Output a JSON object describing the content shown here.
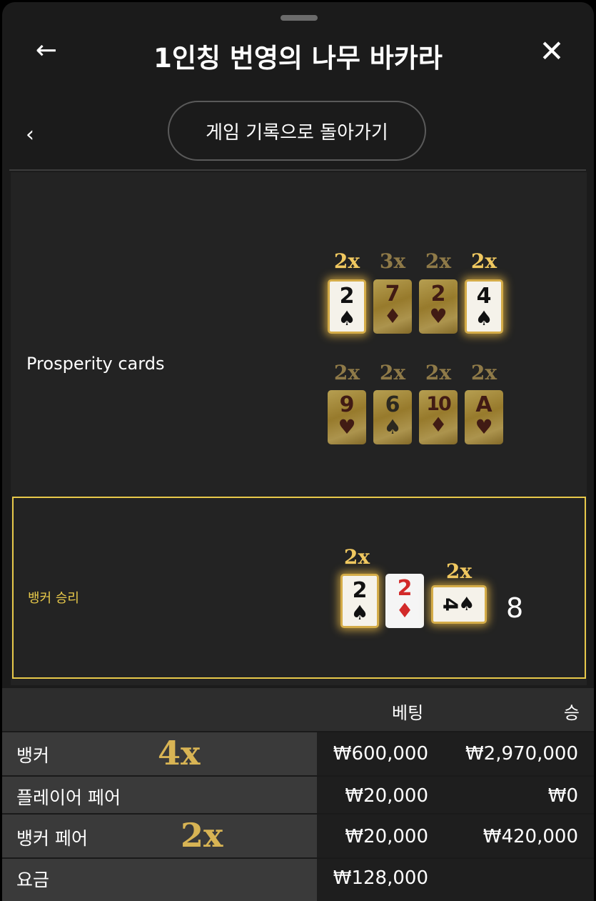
{
  "header": {
    "title": "1인칭 번영의 나무 바카라",
    "back_icon": "←",
    "close_icon": "✕"
  },
  "nav": {
    "prev_icon": "‹",
    "history_button": "게임 기록으로 돌아가기"
  },
  "prosperity": {
    "label": "Prosperity cards",
    "cards": [
      {
        "mult": "2x",
        "rank": "2",
        "suit": "♠",
        "active": true
      },
      {
        "mult": "3x",
        "rank": "7",
        "suit": "♦",
        "active": false
      },
      {
        "mult": "2x",
        "rank": "2",
        "suit": "♥",
        "active": false
      },
      {
        "mult": "2x",
        "rank": "4",
        "suit": "♠",
        "active": true
      },
      {
        "mult": "2x",
        "rank": "9",
        "suit": "♥",
        "active": false
      },
      {
        "mult": "2x",
        "rank": "6",
        "suit": "♠",
        "active": false
      },
      {
        "mult": "2x",
        "rank": "10",
        "suit": "♦",
        "active": false
      },
      {
        "mult": "2x",
        "rank": "A",
        "suit": "♥",
        "active": false
      }
    ]
  },
  "result": {
    "label": "뱅커 승리",
    "cards": [
      {
        "mult": "2x",
        "rank": "2",
        "suit": "♠"
      },
      {
        "mult": "",
        "rank": "2",
        "suit": "♦"
      },
      {
        "mult": "2x",
        "rank": "4",
        "suit": "♠"
      }
    ],
    "score": "8"
  },
  "bets_table": {
    "headers": {
      "bet": "베팅",
      "win": "승"
    },
    "rows": [
      {
        "label": "뱅커",
        "mult": "4x",
        "bet": "₩600,000",
        "win": "₩2,970,000"
      },
      {
        "label": "플레이어 페어",
        "mult": "",
        "bet": "₩20,000",
        "win": "₩0"
      },
      {
        "label": "뱅커 페어",
        "mult": "2x",
        "bet": "₩20,000",
        "win": "₩420,000"
      },
      {
        "label": "요금",
        "mult": "",
        "bet": "₩128,000",
        "win": ""
      }
    ]
  },
  "colors": {
    "accent_gold": "#e8c94a",
    "background": "#1b1b1b",
    "panel": "#232323"
  }
}
